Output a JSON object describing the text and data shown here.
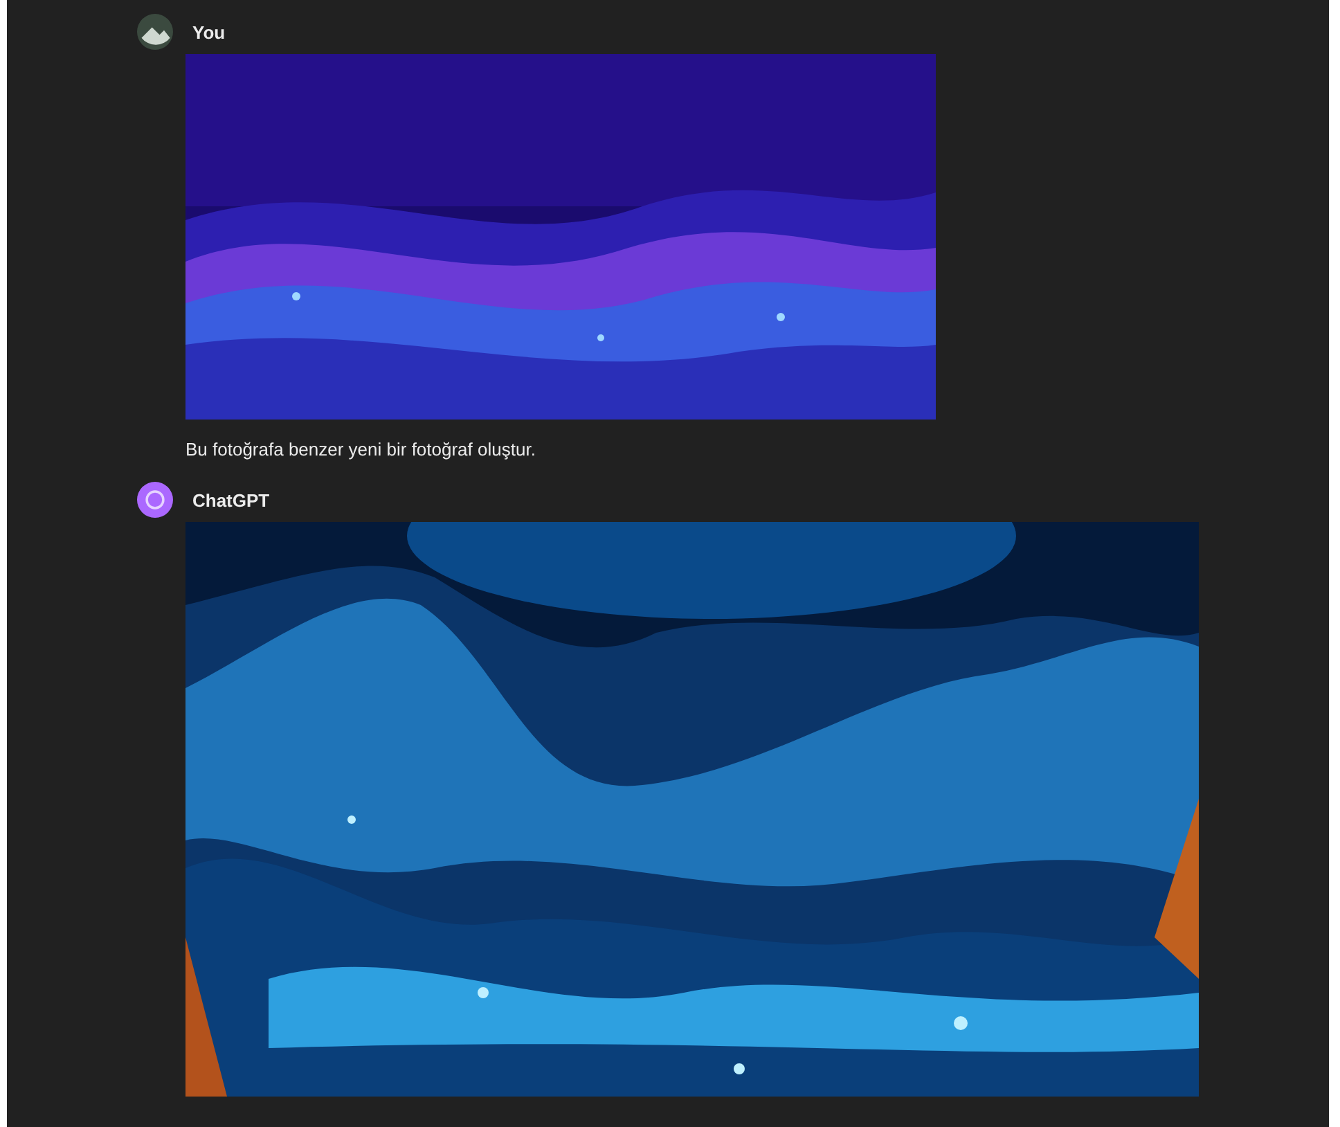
{
  "messages": [
    {
      "author": "You",
      "kind": "user",
      "text": "Bu fotoğrafa benzer yeni bir fotoğraf oluştur."
    },
    {
      "author": "ChatGPT",
      "kind": "assistant"
    }
  ]
}
